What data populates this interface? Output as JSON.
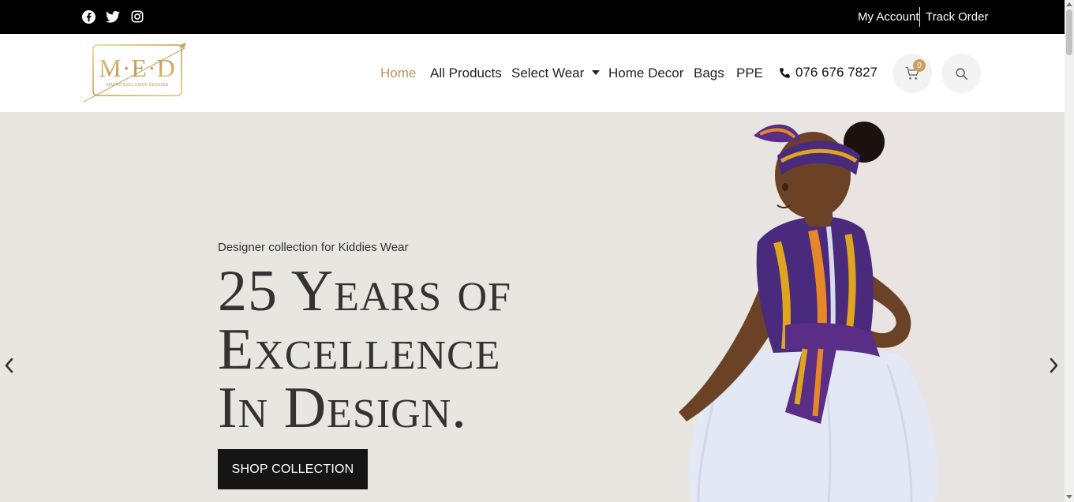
{
  "topbar": {
    "social_icons": [
      "facebook-icon",
      "twitter-icon",
      "instagram-icon"
    ],
    "my_account": "My Account",
    "track_order": "Track Order"
  },
  "header": {
    "logo_text": "M·E·D",
    "logo_subtext": "MAPPO EXCLUSIVE DESIGNS",
    "nav": {
      "home": "Home",
      "all_products": "All Products",
      "select_wear": "Select Wear",
      "home_decor": "Home Decor",
      "bags": "Bags",
      "ppe": "PPE"
    },
    "phone": "076 676 7827",
    "cart_count": "0"
  },
  "hero": {
    "subtitle": "Designer collection for Kiddies Wear",
    "headline_lines": [
      "25 Years of",
      "Excellence",
      "In Design."
    ],
    "cta": "SHOP COLLECTION"
  },
  "colors": {
    "accent": "#b7955a",
    "topbar_bg": "#000000",
    "hero_bg": "#e7e6e1",
    "cta_bg": "#151515"
  }
}
